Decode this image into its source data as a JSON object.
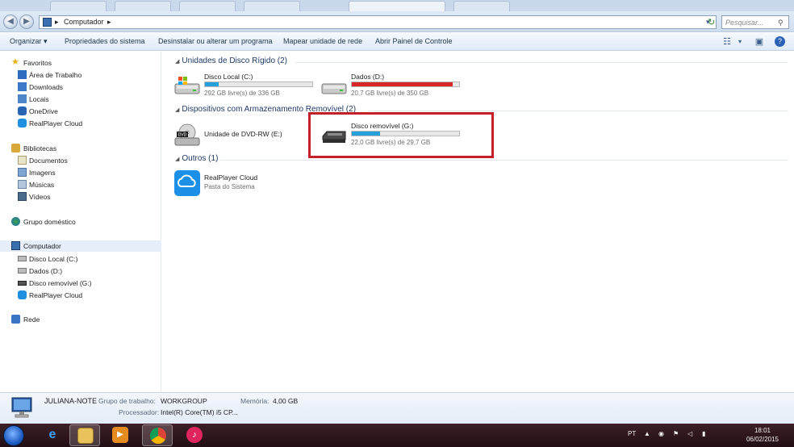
{
  "address": {
    "crumb_root": "▸",
    "crumb": "Computador",
    "crumb_arrow": "▸",
    "search_placeholder": "Pesquisar..."
  },
  "toolbar": {
    "organize": "Organizar ▾",
    "system_properties": "Propriedades do sistema",
    "uninstall": "Desinstalar ou alterar um programa",
    "map_drive": "Mapear unidade de rede",
    "control_panel": "Abrir Painel de Controle"
  },
  "nav": {
    "favorites": {
      "label": "Favoritos",
      "items": [
        "Área de Trabalho",
        "Downloads",
        "Locais",
        "OneDrive",
        "RealPlayer Cloud"
      ]
    },
    "libraries": {
      "label": "Bibliotecas",
      "items": [
        "Documentos",
        "Imagens",
        "Músicas",
        "Vídeos"
      ]
    },
    "homegroup": "Grupo doméstico",
    "computer": {
      "label": "Computador",
      "items": [
        "Disco Local (C:)",
        "Dados (D:)",
        "Disco removível (G:)",
        "RealPlayer Cloud"
      ]
    },
    "network": "Rede"
  },
  "groups": {
    "hard_disks": "Unidades de Disco Rígido (2)",
    "removable": "Dispositivos com Armazenamento Removível (2)",
    "others": "Outros (1)"
  },
  "drives": {
    "c": {
      "name": "Disco Local (C:)",
      "free": "292 GB livre(s) de 336 GB",
      "used_fraction": 0.13,
      "bar_color": "#26a0da"
    },
    "d": {
      "name": "Dados (D:)",
      "free": "20,7 GB livre(s) de 350 GB",
      "used_fraction": 0.94,
      "bar_color": "#da2626"
    },
    "dvd": {
      "name": "Unidade de DVD-RW (E:)"
    },
    "g": {
      "name": "Disco removível (G:)",
      "free": "22,0 GB livre(s) de 29,7 GB",
      "used_fraction": 0.26,
      "bar_color": "#26a0da"
    },
    "cloud": {
      "name": "RealPlayer Cloud",
      "subtitle": "Pasta do Sistema"
    }
  },
  "details": {
    "computer_name": "JULIANA-NOTE",
    "workgroup_label": "Grupo de trabalho:",
    "workgroup": "WORKGROUP",
    "memory_label": "Memória:",
    "memory": "4,00 GB",
    "processor_label": "Processador:",
    "processor": "Intel(R) Core(TM) i5 CP..."
  },
  "taskbar": {
    "lang": "PT",
    "time": "18:01",
    "date": "06/02/2015"
  }
}
